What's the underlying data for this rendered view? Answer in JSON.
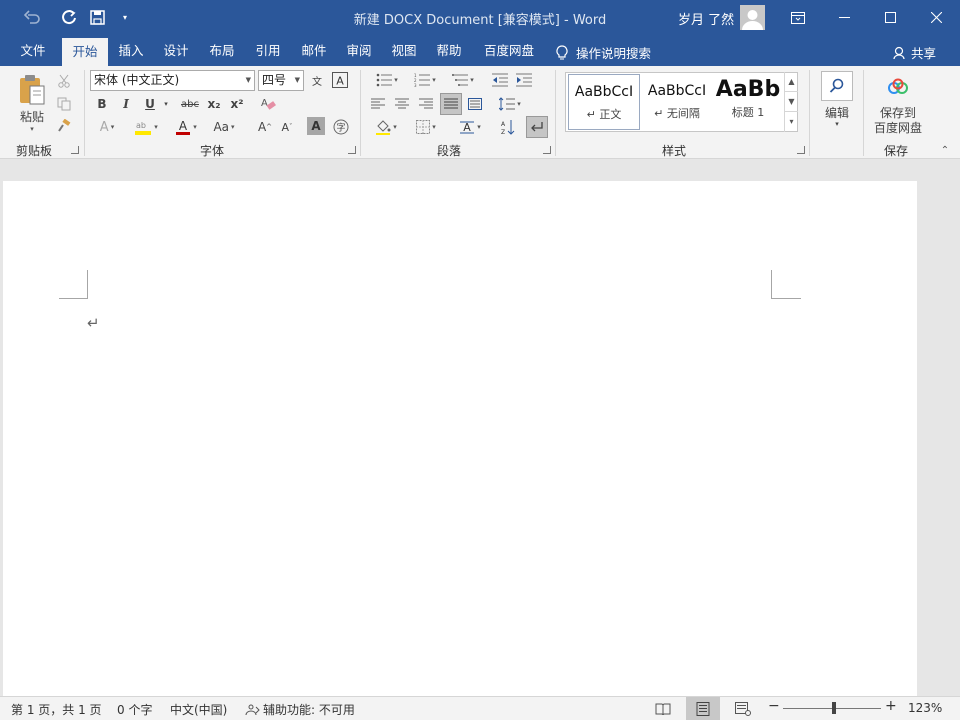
{
  "titlebar": {
    "title": "新建 DOCX Document [兼容模式]  -  Word",
    "user_name": "岁月 了然",
    "accent": "#2b579a"
  },
  "tabs": [
    {
      "label": "文件"
    },
    {
      "label": "开始"
    },
    {
      "label": "插入"
    },
    {
      "label": "设计"
    },
    {
      "label": "布局"
    },
    {
      "label": "引用"
    },
    {
      "label": "邮件"
    },
    {
      "label": "审阅"
    },
    {
      "label": "视图"
    },
    {
      "label": "帮助"
    },
    {
      "label": "百度网盘"
    }
  ],
  "tell_me": "操作说明搜索",
  "share": "共享",
  "ribbon": {
    "clipboard": {
      "paste": "粘贴",
      "group": "剪贴板"
    },
    "font": {
      "font_name": "宋体 (中文正文)",
      "font_size": "四号",
      "bold": "B",
      "italic": "I",
      "underline": "U",
      "strikethrough": "abc",
      "subscript": "x₂",
      "superscript": "x²",
      "change_case": "Aa",
      "grow": "A",
      "shrink": "A",
      "shade": "A",
      "group": "字体"
    },
    "paragraph": {
      "group": "段落"
    },
    "styles": {
      "items": [
        {
          "preview": "AaBbCcI",
          "name": "↵ 正文"
        },
        {
          "preview": "AaBbCcI",
          "name": "↵ 无间隔"
        },
        {
          "preview": "AaBb",
          "name": "标题 1"
        }
      ],
      "group": "样式"
    },
    "editing": {
      "label": "编辑"
    },
    "save": {
      "label_line1": "保存到",
      "label_line2": "百度网盘",
      "group": "保存"
    }
  },
  "document": {
    "paragraph_mark": "↵"
  },
  "statusbar": {
    "page": "第 1 页，共 1 页",
    "words": "0 个字",
    "language": "中文(中国)",
    "accessibility": "辅助功能: 不可用",
    "zoom": "123%",
    "zoom_minus": "−",
    "zoom_plus": "+"
  }
}
